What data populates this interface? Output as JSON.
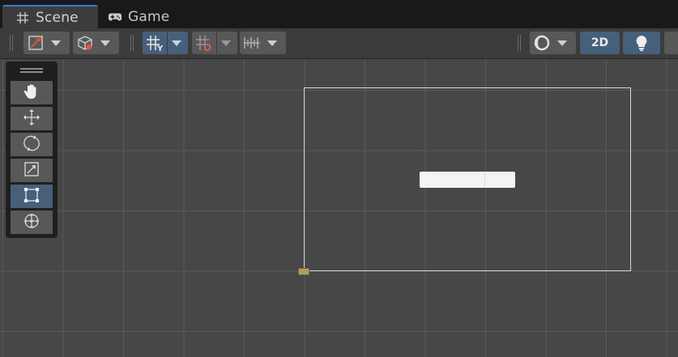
{
  "tabs": [
    {
      "label": "Scene",
      "icon": "grid-hash-icon",
      "active": true
    },
    {
      "label": "Game",
      "icon": "gamepad-icon",
      "active": false
    }
  ],
  "toolbar": {
    "draw_mode_icon": "draw-mode-icon",
    "scene_gizmo_icon": "scene-cube-icon",
    "grid_visibility_icon": "grid-visibility-icon",
    "grid_snapping_icon": "grid-snap-icon",
    "increment_snap_icon": "increment-snap-icon",
    "shading_icon": "shading-sphere-icon",
    "mode_2d_label": "2D",
    "lighting_icon": "lightbulb-icon"
  },
  "tools": [
    {
      "name": "hand-tool",
      "icon": "hand-icon",
      "active": false
    },
    {
      "name": "move-tool",
      "icon": "move-arrows-icon",
      "active": false
    },
    {
      "name": "rotate-tool",
      "icon": "rotate-icon",
      "active": false
    },
    {
      "name": "scale-tool",
      "icon": "scale-icon",
      "active": false
    },
    {
      "name": "rect-tool",
      "icon": "rect-transform-icon",
      "active": true
    },
    {
      "name": "transform-tool",
      "icon": "transform-icon",
      "active": false
    }
  ],
  "colors": {
    "accent_blue": "#46607c",
    "tab_underline": "#3d7ad6",
    "scene_background": "#474747",
    "grid_line": "#5a5a5a",
    "button_gray": "#585858"
  }
}
